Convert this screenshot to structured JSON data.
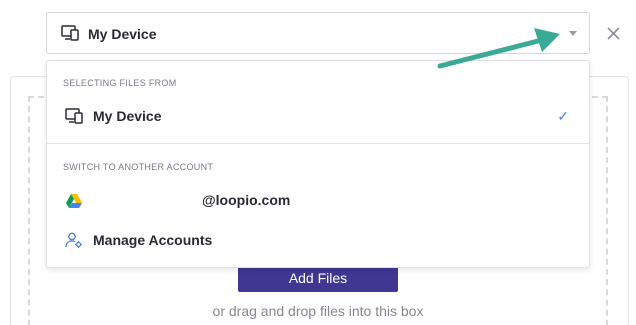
{
  "source_select": {
    "selected_label": "My Device",
    "icon": "device-icon"
  },
  "dropdown": {
    "section_selecting": "SELECTING FILES FROM",
    "device_item_label": "My Device",
    "device_item_check": "✓",
    "section_switch": "SWITCH TO ANOTHER ACCOUNT",
    "google_account_email": "@loopio.com",
    "manage_accounts_label": "Manage Accounts"
  },
  "upload": {
    "add_files_label": "Add Files",
    "drop_hint": "or drag and drop files into this box"
  },
  "colors": {
    "accent_button": "#3f3791",
    "annotation_arrow": "#3aaa96",
    "checkmark": "#4a7fd1"
  }
}
